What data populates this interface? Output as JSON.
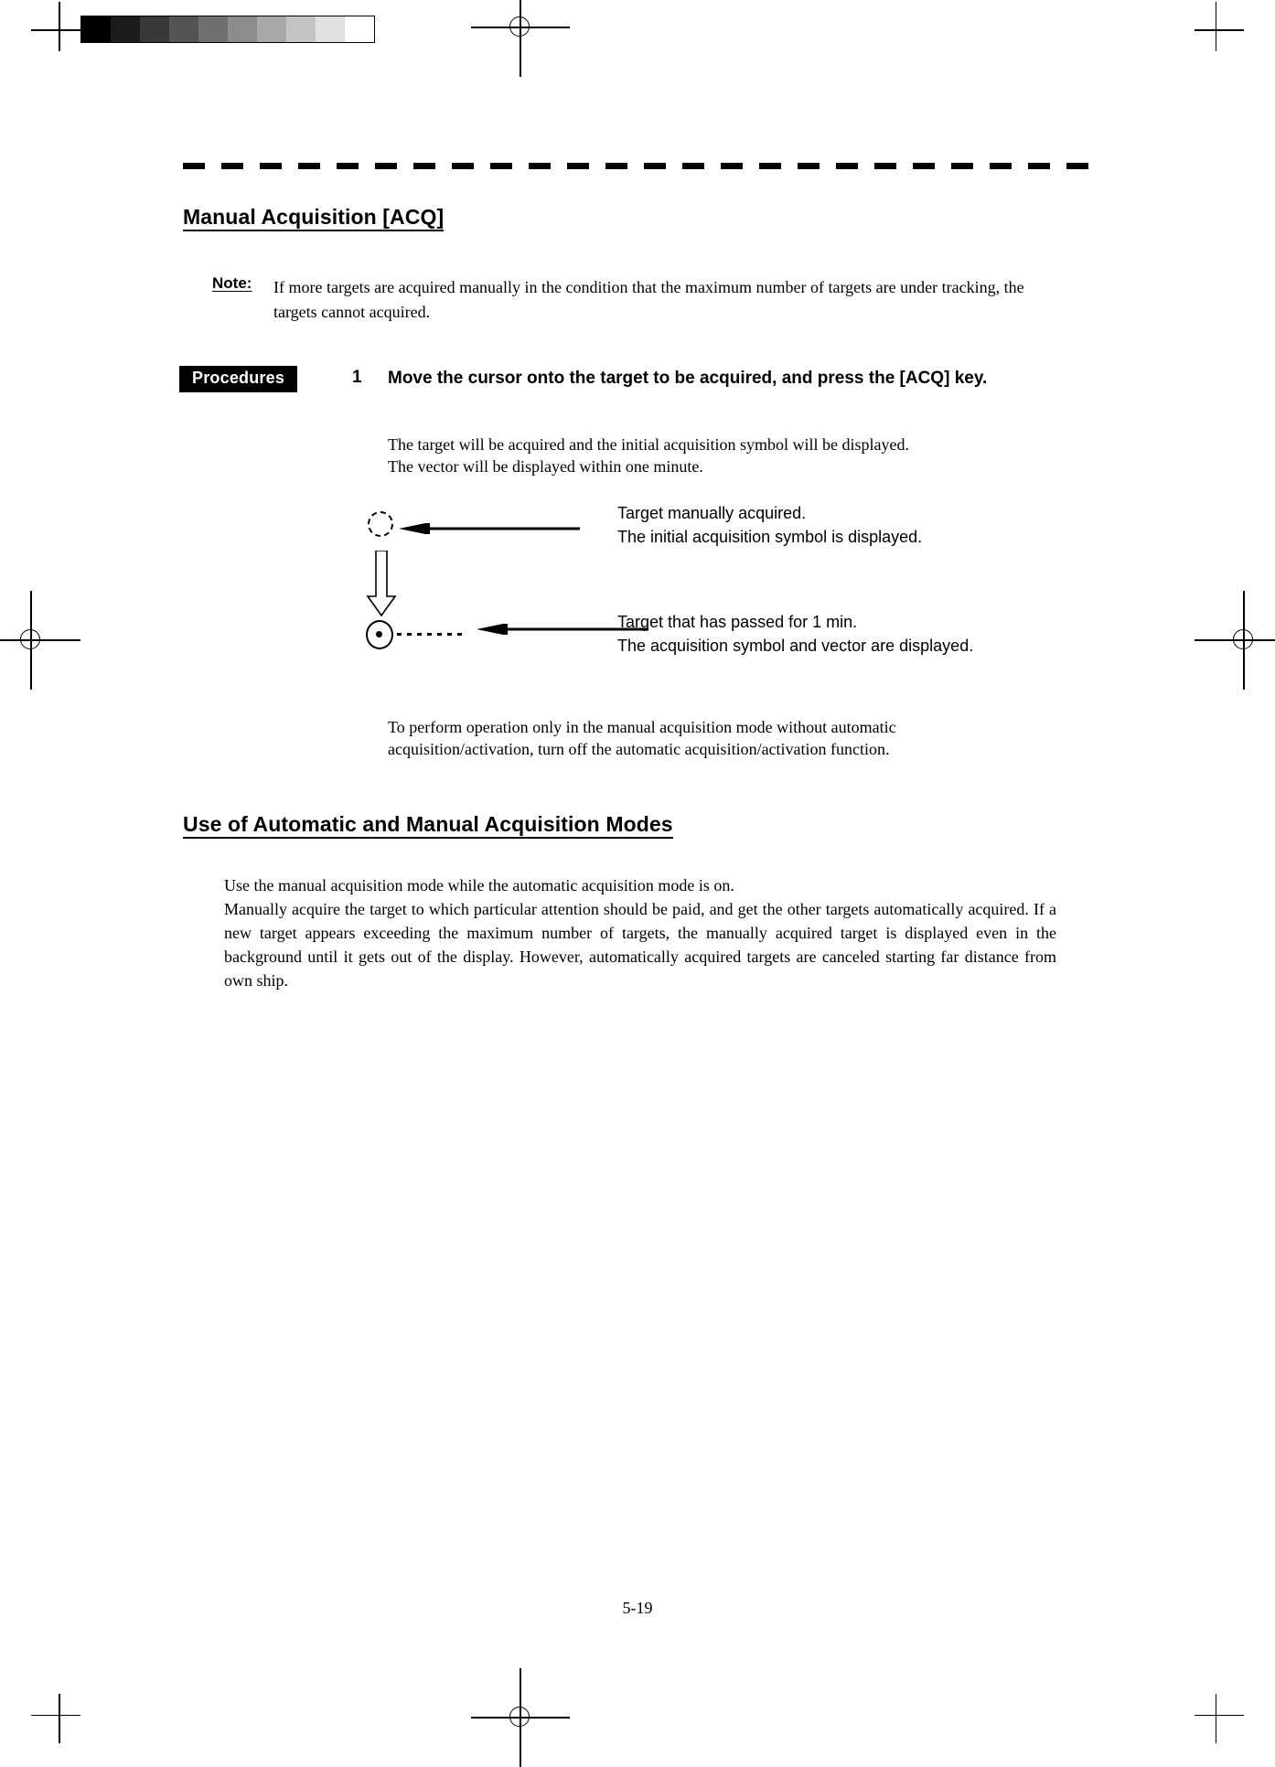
{
  "document": {
    "page_number": "5-19",
    "grayscale_strip": [
      "#000000",
      "#1c1c1c",
      "#383838",
      "#545454",
      "#707070",
      "#8c8c8c",
      "#a8a8a8",
      "#c4c4c4",
      "#e0e0e0",
      "#ffffff"
    ]
  },
  "section_one": {
    "title": "Manual Acquisition [ACQ]",
    "note": {
      "label": "Note:",
      "text": "If more targets are acquired manually in the condition that the maximum number of targets are under tracking, the targets cannot acquired."
    },
    "procedures_badge": "Procedures",
    "step": {
      "number": "1",
      "heading": "Move the cursor onto the target to be acquired, and press the [ACQ] key.",
      "description_line_1": "The target will be acquired and the initial acquisition symbol will be displayed.",
      "description_line_2": "The vector will be displayed within one minute."
    },
    "diagram": {
      "callout_top_line_1": "Target manually acquired.",
      "callout_top_line_2": "The initial acquisition symbol is displayed.",
      "callout_bottom_line_1": "Target that has passed for 1 min.",
      "callout_bottom_line_2": "The acquisition symbol and vector are displayed."
    },
    "closing_line_1": "To perform operation only in the manual acquisition mode without automatic",
    "closing_line_2": "acquisition/activation, turn off the automatic acquisition/activation function."
  },
  "section_two": {
    "title": "Use of Automatic and Manual Acquisition Modes",
    "paragraph_line_1": "Use the manual acquisition mode while the automatic acquisition mode is on.",
    "paragraph_rest": "Manually acquire the target to which particular attention should be paid, and get the other targets automatically acquired.  If a new target appears exceeding the maximum number of targets, the manually acquired target is displayed even in the background until it gets out of the display.  However, automatically acquired targets are canceled starting far distance from own ship."
  }
}
